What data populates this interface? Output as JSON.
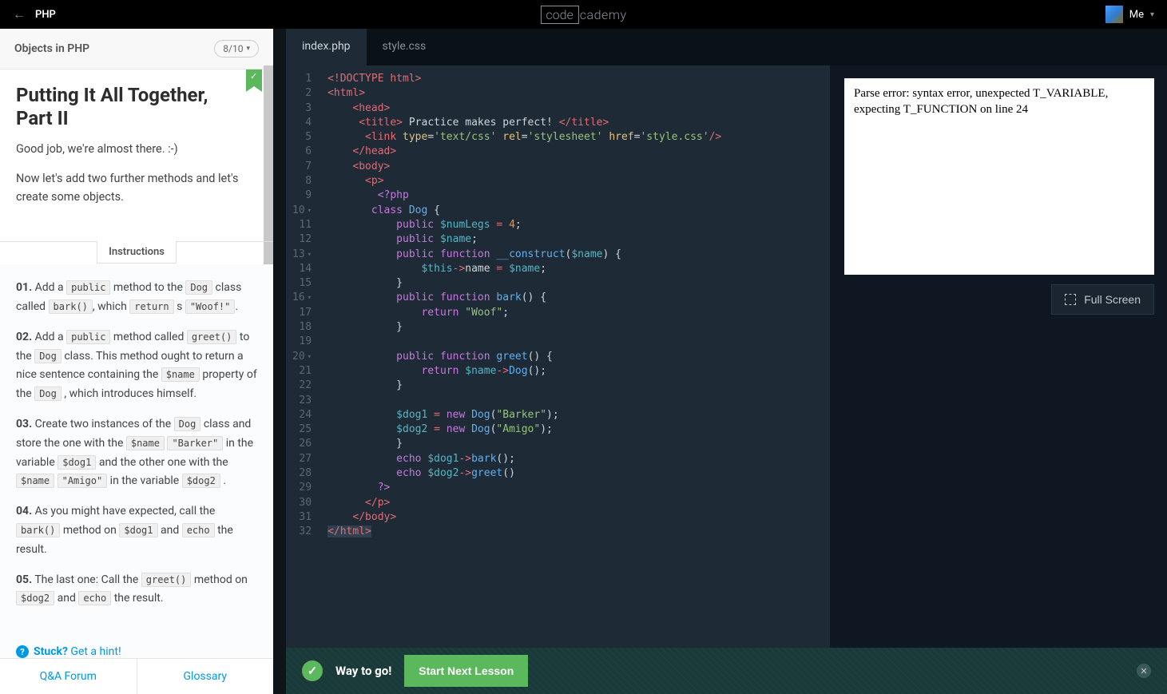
{
  "topbar": {
    "course": "PHP",
    "me": "Me"
  },
  "logo": {
    "box": "code",
    "rest": "cademy"
  },
  "lesson": {
    "header": "Objects in PHP",
    "progress": "8/10",
    "title": "Putting It All Together, Part II",
    "intro1": "Good job, we're almost there. :-)",
    "intro2": "Now let's add two further methods and let's create some objects.",
    "instructions_label": "Instructions"
  },
  "steps": {
    "s1": {
      "num": "01.",
      "t1": " Add a ",
      "c1": "public",
      "t2": " method to the ",
      "c2": "Dog",
      "t3": " class called ",
      "c3": "bark()",
      "t4": ", which ",
      "c4": "return",
      "t5": " s ",
      "c5": "\"Woof!\"",
      "t6": "."
    },
    "s2": {
      "num": "02.",
      "t1": " Add a ",
      "c1": "public",
      "t2": " method called ",
      "c2": "greet()",
      "t3": " to the ",
      "c3": "Dog",
      "t4": " class. This method ought to return a nice sentence containing the ",
      "c4": "$name",
      "t5": " property of the ",
      "c5": "Dog",
      "t6": " , which introduces himself."
    },
    "s3": {
      "num": "03.",
      "t1": " Create two instances of the ",
      "c1": "Dog",
      "t2": " class and store the one with the ",
      "c2": "$name",
      "t3": " ",
      "c3": "\"Barker\"",
      "t4": " in the variable ",
      "c4": "$dog1",
      "t5": " and the other one with the ",
      "c5": "$name",
      "t6": " ",
      "c6": "\"Amigo\"",
      "t7": " in the variable ",
      "c7": "$dog2",
      "t8": " ."
    },
    "s4": {
      "num": "04.",
      "t1": " As you might have expected, call the ",
      "c1": "bark()",
      "t2": " method on ",
      "c2": "$dog1",
      "t3": " and ",
      "c3": "echo",
      "t4": " the result."
    },
    "s5": {
      "num": "05.",
      "t1": " The last one: Call the ",
      "c1": "greet()",
      "t2": " method on ",
      "c2": "$dog2",
      "t3": " and ",
      "c3": "echo",
      "t4": " the result."
    }
  },
  "hint": {
    "stuck": "Stuck?",
    "get": " Get a hint!"
  },
  "bottom_tabs": {
    "qa": "Q&A Forum",
    "glossary": "Glossary"
  },
  "tabs": {
    "index": "index.php",
    "style": "style.css"
  },
  "preview": {
    "error": "Parse error: syntax error, unexpected T_VARIABLE, expecting T_FUNCTION on line 24",
    "fullscreen": "Full Screen"
  },
  "footer": {
    "way": "Way to go!",
    "next": "Start Next Lesson"
  },
  "code_lines": [
    "1",
    "2",
    "3",
    "4",
    "5",
    "6",
    "7",
    "8",
    "9",
    "10",
    "11",
    "12",
    "13",
    "14",
    "15",
    "16",
    "17",
    "18",
    "19",
    "20",
    "21",
    "22",
    "23",
    "24",
    "25",
    "26",
    "27",
    "28",
    "29",
    "30",
    "31",
    "32"
  ]
}
